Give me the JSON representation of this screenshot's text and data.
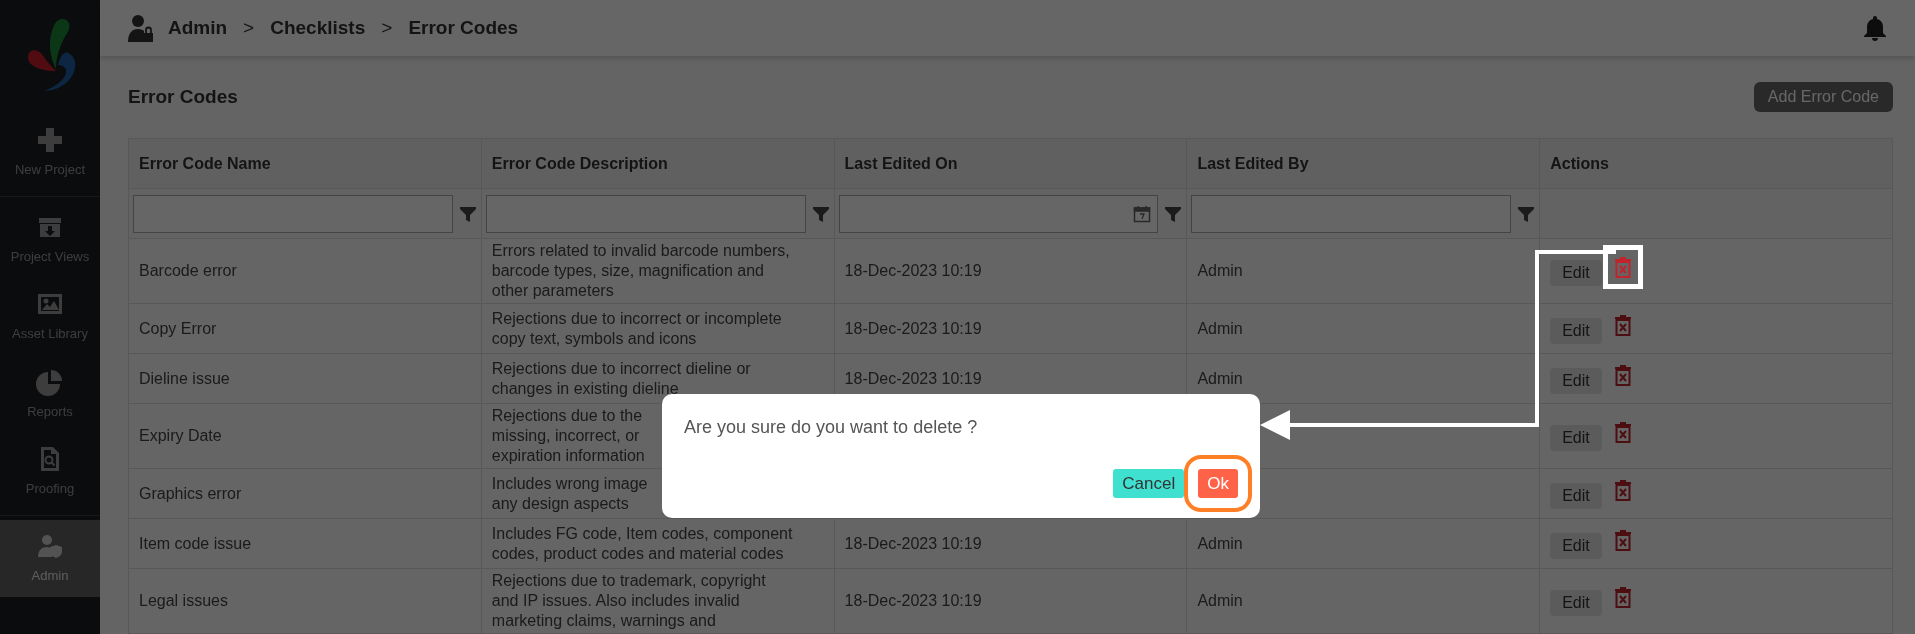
{
  "sidebar": {
    "groups": [
      [
        {
          "label": "New Project",
          "selected": false
        }
      ],
      [
        {
          "label": "Project Views",
          "selected": false
        },
        {
          "label": "Asset Library",
          "selected": false
        },
        {
          "label": "Reports",
          "selected": false
        },
        {
          "label": "Proofing",
          "selected": false
        }
      ],
      [
        {
          "label": "Admin",
          "selected": true
        }
      ]
    ]
  },
  "breadcrumb": {
    "items": [
      "Admin",
      "Checklists",
      "Error Codes"
    ],
    "separator": ">"
  },
  "page_title": "Error Codes",
  "add_button": "Add Error Code",
  "table": {
    "columns": [
      {
        "label": "Error Code Name",
        "kind": "text"
      },
      {
        "label": "Error Code Description",
        "kind": "text"
      },
      {
        "label": "Last Edited On",
        "kind": "date"
      },
      {
        "label": "Last Edited By",
        "kind": "text"
      },
      {
        "label": "Actions",
        "kind": "none"
      }
    ],
    "rows": [
      {
        "name": "Barcode error",
        "description": [
          "Errors related to invalid barcode numbers,",
          "barcode types, size, magnification and",
          "other parameters"
        ],
        "edited_on": "18-Dec-2023 10:19",
        "edited_by": "Admin",
        "edit": "Edit",
        "highlighted": true
      },
      {
        "name": "Copy Error",
        "description": [
          "Rejections due to incorrect or incomplete",
          "copy text, symbols and icons"
        ],
        "edited_on": "18-Dec-2023 10:19",
        "edited_by": "Admin",
        "edit": "Edit",
        "highlighted": false
      },
      {
        "name": "Dieline issue",
        "description": [
          "Rejections due to incorrect dieline or",
          "changes in existing dieline"
        ],
        "edited_on": "18-Dec-2023 10:19",
        "edited_by": "Admin",
        "edit": "Edit",
        "highlighted": false
      },
      {
        "name": "Expiry Date",
        "description": [
          "Rejections due to the",
          "missing, incorrect, or",
          "expiration information"
        ],
        "edit": "Edit",
        "highlighted": false
      },
      {
        "name": "Graphics error",
        "description": [
          "Includes wrong image",
          "any design aspects"
        ],
        "edit": "Edit",
        "highlighted": false
      },
      {
        "name": "Item code issue",
        "description": [
          "Includes FG code, Item codes, component",
          "codes, product codes and material codes"
        ],
        "edited_on": "18-Dec-2023 10:19",
        "edited_by": "Admin",
        "edit": "Edit",
        "highlighted": false
      },
      {
        "name": "Legal issues",
        "description": [
          "Rejections due to trademark, copyright",
          "and IP issues. Also includes invalid",
          "marketing claims, warnings and"
        ],
        "edited_on": "18-Dec-2023 10:19",
        "edited_by": "Admin",
        "edit": "Edit",
        "highlighted": false
      }
    ]
  },
  "dialog": {
    "message": "Are you sure do you want to delete ?",
    "buttons": [
      {
        "label": "Cancel",
        "kind": "cancel",
        "highlighted": false
      },
      {
        "label": "Ok",
        "kind": "confirm",
        "highlighted": true
      }
    ]
  }
}
